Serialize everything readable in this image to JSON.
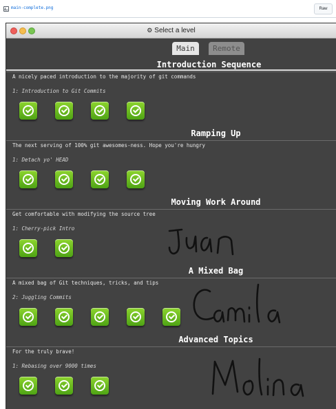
{
  "file_header": {
    "file_name": "main-complete.png",
    "raw_label": "Raw"
  },
  "window": {
    "title": "Select a level",
    "icon": "gear-icon"
  },
  "tabs": [
    {
      "label": "Main",
      "active": true
    },
    {
      "label": "Remote",
      "active": false
    }
  ],
  "sequences": [
    {
      "title": "Introduction Sequence",
      "description": "A nicely paced introduction to the majority of git commands",
      "level_name": "1: Introduction to Git Commits",
      "completed_count": 4
    },
    {
      "title": "Ramping Up",
      "description": "The next serving of 100% git awesomes-ness. Hope you're hungry",
      "level_name": "1: Detach yo' HEAD",
      "completed_count": 4
    },
    {
      "title": "Moving Work Around",
      "description": "Get comfortable with modifying the source tree",
      "level_name": "1: Cherry-pick Intro",
      "completed_count": 2
    },
    {
      "title": "A Mixed Bag",
      "description": "A mixed bag of Git techniques, tricks, and tips",
      "level_name": "2: Juggling Commits",
      "completed_count": 5
    },
    {
      "title": "Advanced Topics",
      "description": "For the truly brave!",
      "level_name": "1: Rebasing over 9000 times",
      "completed_count": 3
    }
  ],
  "signature": [
    "Juan",
    "Camila",
    "Molina"
  ],
  "colors": {
    "window_background": "#424242",
    "level_complete_green": "#6bbd1e",
    "tab_active": "#e6e6e6",
    "tab_inactive": "#8d8d8d"
  }
}
